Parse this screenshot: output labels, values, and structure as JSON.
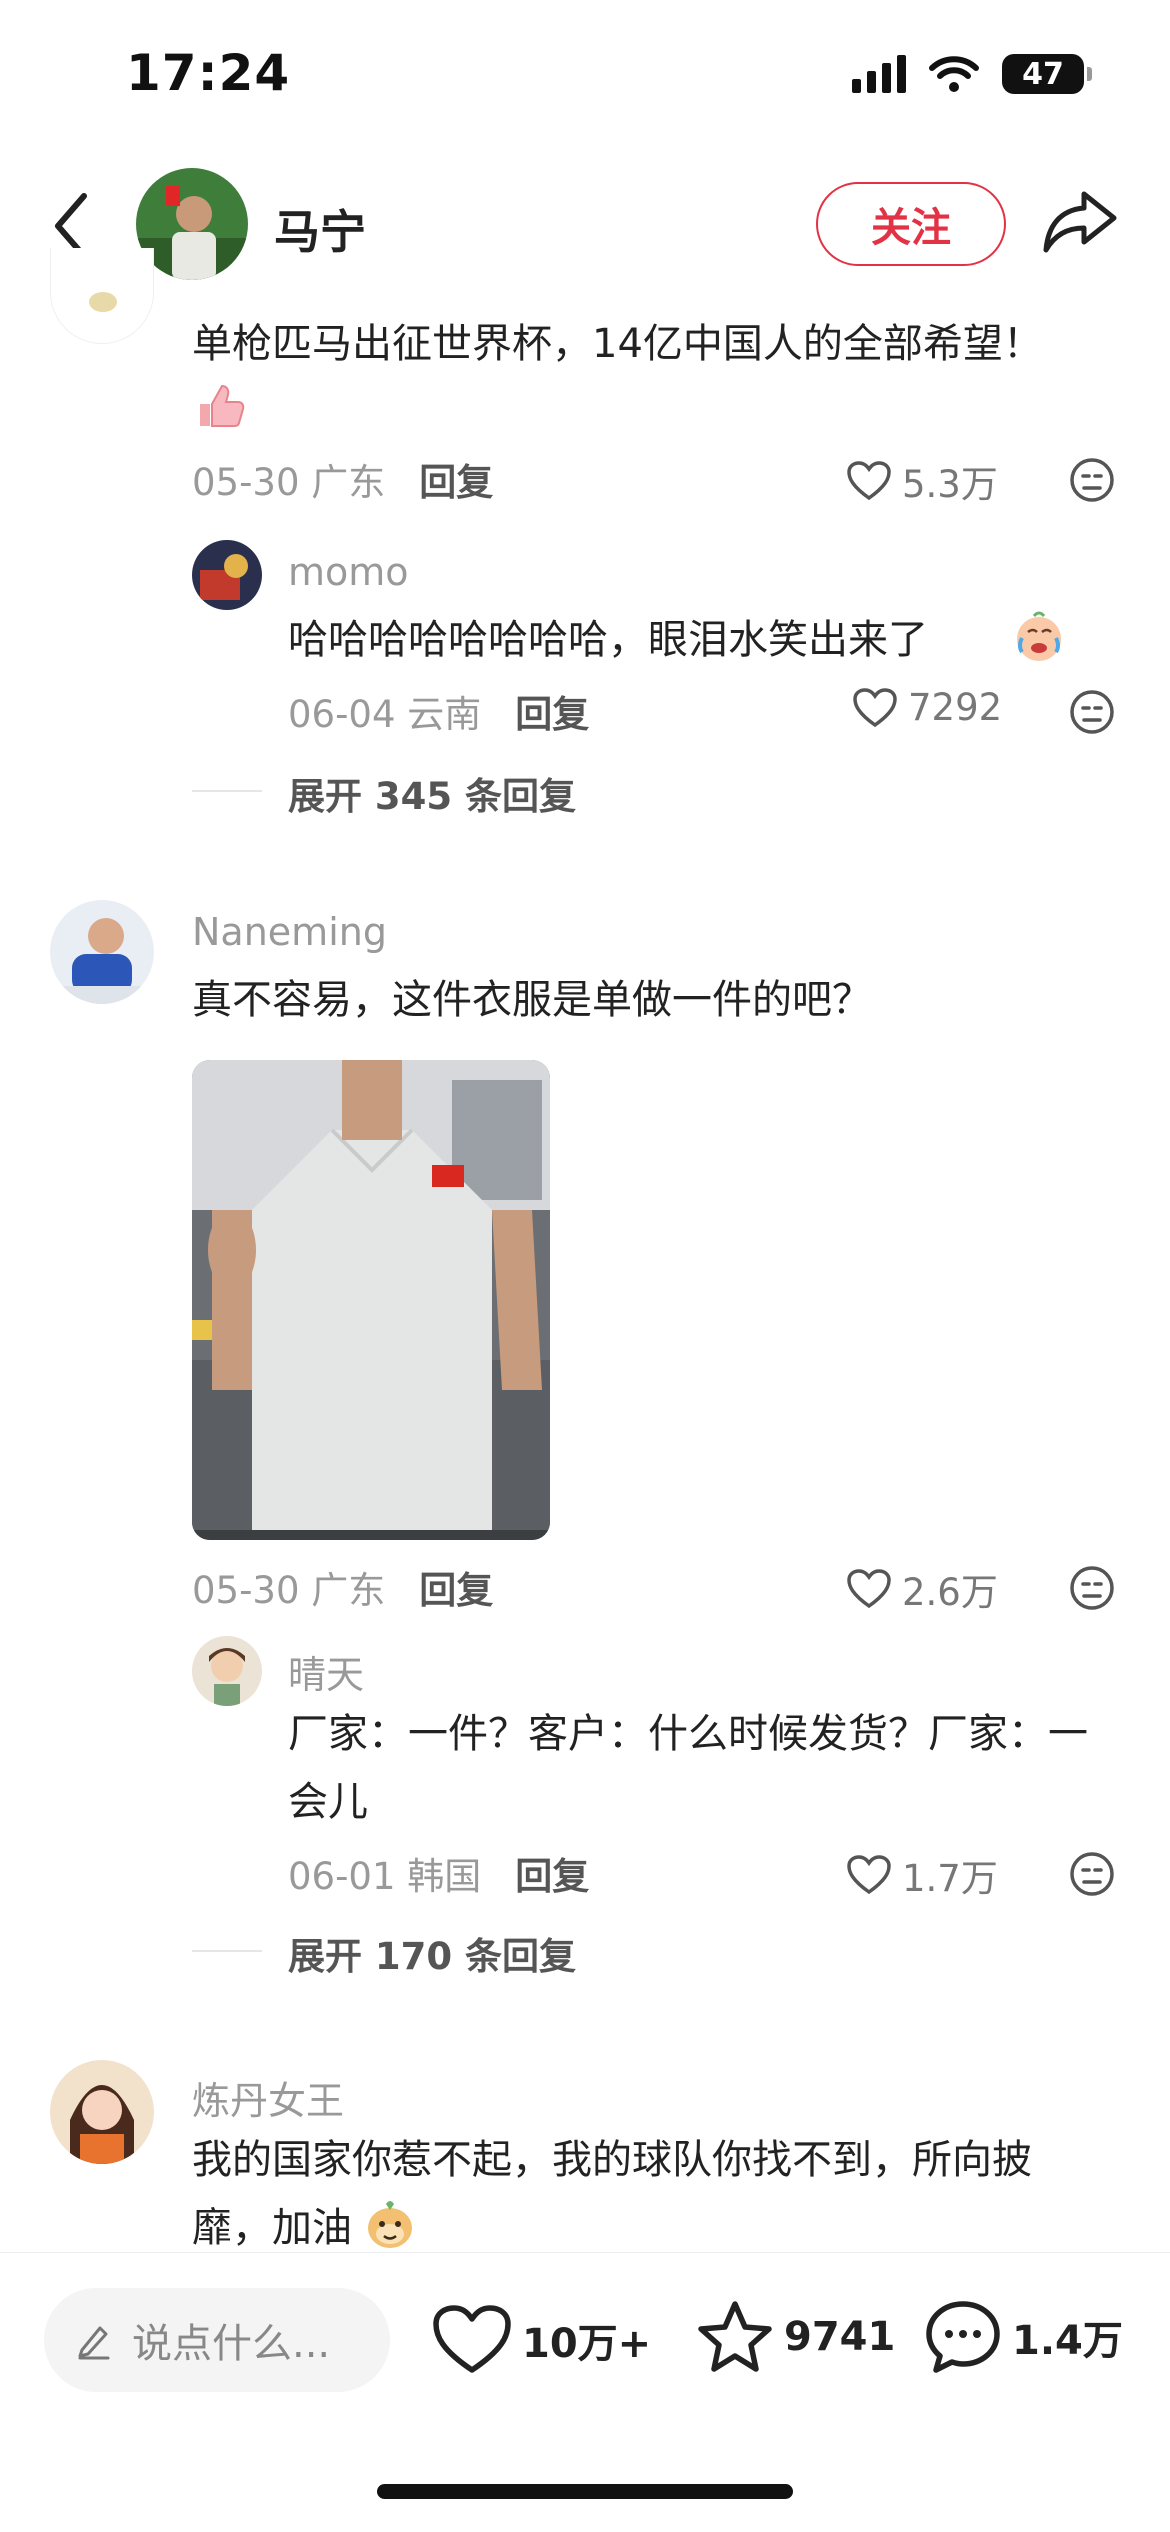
{
  "status_bar": {
    "time": "17:24",
    "battery": "47"
  },
  "header": {
    "name": "马宁",
    "follow_label": "关注"
  },
  "comments": [
    {
      "text": "单枪匹马出征世界杯，14亿中国人的全部希望！",
      "date": "05-30",
      "location": "广东",
      "reply_label": "回复",
      "likes": "5.3万",
      "reply": {
        "user": "momo",
        "text": "哈哈哈哈哈哈哈哈，眼泪水笑出来了",
        "date": "06-04",
        "location": "云南",
        "reply_label": "回复",
        "likes": "7292"
      },
      "expand": "展开 345 条回复"
    },
    {
      "user": "Naneming",
      "text": "真不容易，这件衣服是单做一件的吧？",
      "date": "05-30",
      "location": "广东",
      "reply_label": "回复",
      "likes": "2.6万",
      "reply": {
        "user": "晴天",
        "text": "厂家：一件？客户：什么时候发货？厂家：一会儿",
        "date": "06-01",
        "location": "韩国",
        "reply_label": "回复",
        "likes": "1.7万"
      },
      "expand": "展开 170 条回复"
    },
    {
      "user": "炼丹女王",
      "text": "我的国家你惹不起，我的球队你找不到，所向披靡，加油"
    }
  ],
  "bottom_bar": {
    "input_placeholder": "说点什么...",
    "likes": "10万+",
    "favorites": "9741",
    "comments": "1.4万"
  },
  "colors": {
    "accent": "#e23245"
  }
}
